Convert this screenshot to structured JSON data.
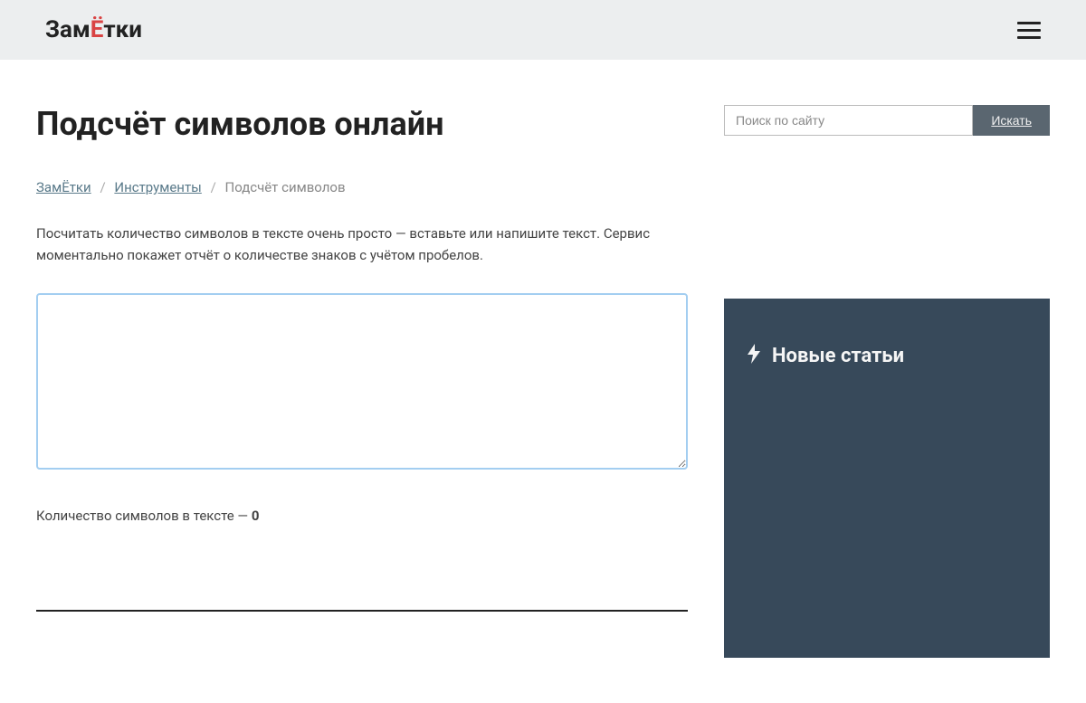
{
  "header": {
    "logo_part1": "Зам",
    "logo_accent": "Ё",
    "logo_part2": "тки"
  },
  "page": {
    "title": "Подсчёт символов онлайн"
  },
  "breadcrumb": {
    "home": "ЗамЁтки",
    "tools": "Инструменты",
    "current": "Подсчёт символов",
    "separator": "/"
  },
  "description": "Посчитать количество символов в тексте очень просто — вставьте или напишите текст. Сервис моментально покажет отчёт о количестве знаков с учётом пробелов.",
  "textarea": {
    "value": ""
  },
  "count": {
    "label": "Количество символов в тексте — ",
    "value": "0"
  },
  "search": {
    "placeholder": "Поиск по сайту",
    "button": "Искать"
  },
  "widget": {
    "title": "Новые статьи"
  }
}
